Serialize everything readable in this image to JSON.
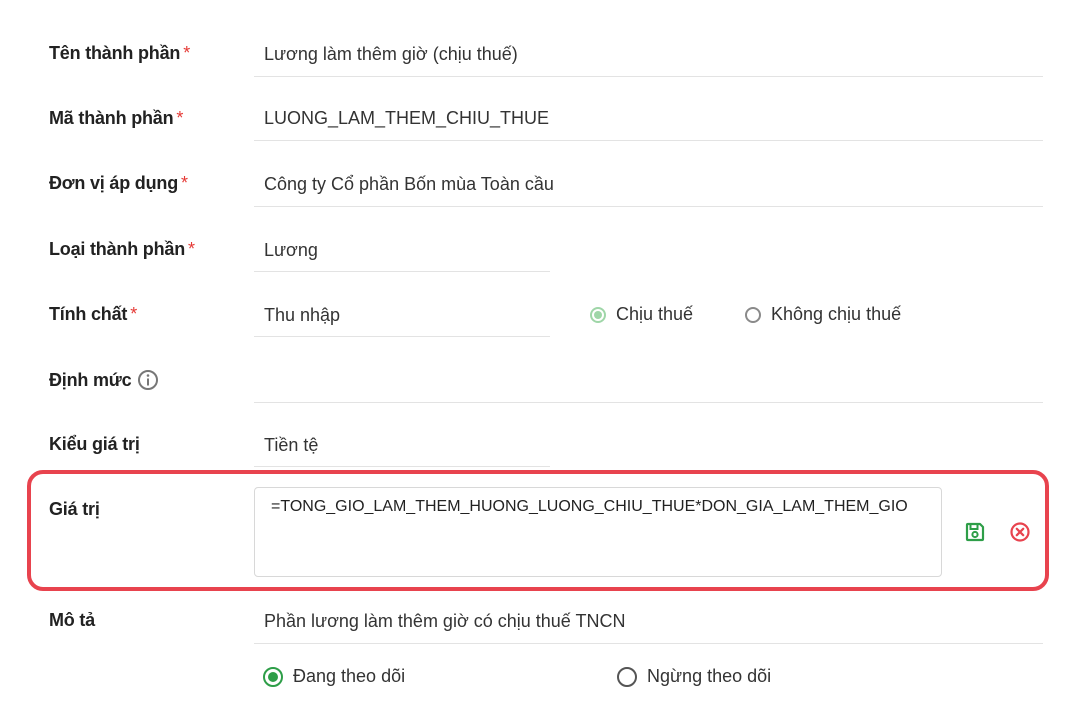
{
  "fields": {
    "ten_thanh_phan": {
      "label": "Tên thành phần",
      "required": "*",
      "value": "Lương làm thêm giờ (chịu thuế)"
    },
    "ma_thanh_phan": {
      "label": "Mã thành phần",
      "required": "*",
      "value": "LUONG_LAM_THEM_CHIU_THUE"
    },
    "don_vi": {
      "label": "Đơn vị áp dụng",
      "required": "*",
      "value": "Công ty Cổ phần Bốn mùa Toàn cầu"
    },
    "loai": {
      "label": "Loại thành phần",
      "required": "*",
      "value": "Lương"
    },
    "tinh_chat": {
      "label": "Tính chất",
      "required": "*",
      "value": "Thu nhập",
      "options": [
        "Chịu thuế",
        "Không chịu thuế"
      ],
      "selected": "Chịu thuế"
    },
    "dinh_muc": {
      "label": "Định mức",
      "value": ""
    },
    "kieu_gia_tri": {
      "label": "Kiểu giá trị",
      "value": "Tiền tệ"
    },
    "gia_tri": {
      "label": "Giá trị",
      "value": "=TONG_GIO_LAM_THEM_HUONG_LUONG_CHIU_THUE*DON_GIA_LAM_THEM_GIO"
    },
    "mo_ta": {
      "label": "Mô tả",
      "value": "Phần lương làm thêm giờ có chịu thuế TNCN"
    }
  },
  "status": {
    "options": [
      "Đang theo dõi",
      "Ngừng theo dõi"
    ],
    "selected": "Đang theo dõi"
  },
  "colors": {
    "accent_green": "#2e9e48",
    "required_red": "#e53935",
    "highlight_red": "#e8434e"
  },
  "icons": {
    "save": "save-icon",
    "cancel": "close-circle-icon",
    "info": "info-icon"
  }
}
